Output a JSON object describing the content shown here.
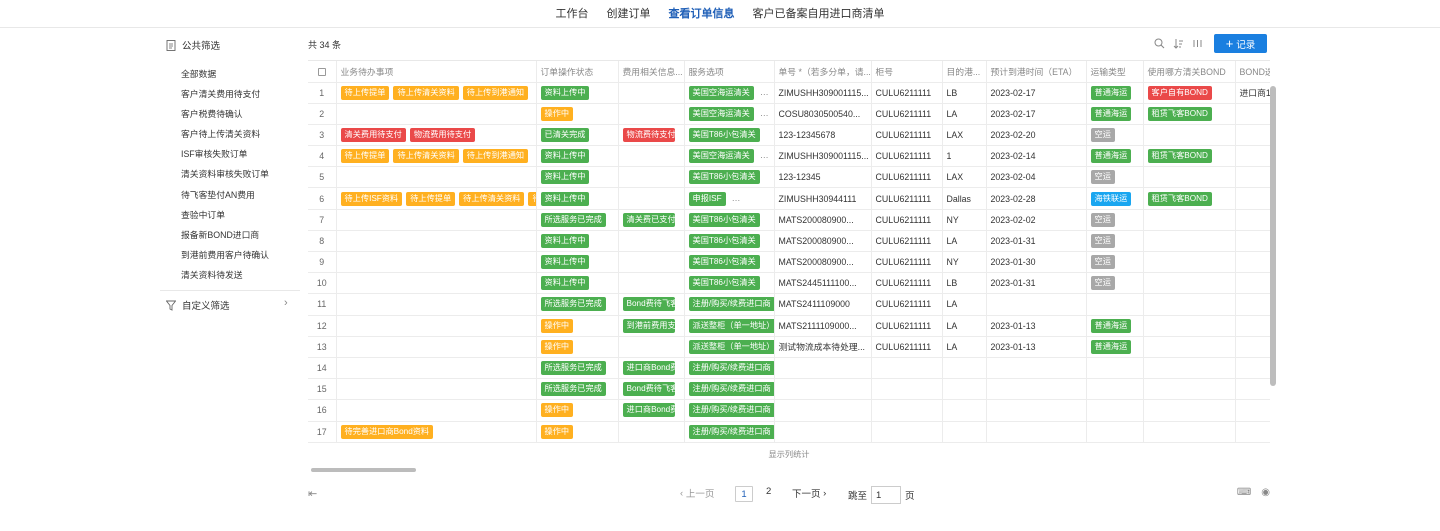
{
  "nav": {
    "tabs": [
      {
        "label": "工作台",
        "active": false
      },
      {
        "label": "创建订单",
        "active": false
      },
      {
        "label": "查看订单信息",
        "active": true
      },
      {
        "label": "客户已备案自用进口商清单",
        "active": false
      }
    ]
  },
  "sidebar": {
    "public_title": "公共筛选",
    "filters": [
      "全部数据",
      "客户清关费用待支付",
      "客户税费待确认",
      "客户待上传清关资料",
      "ISF审核失败订单",
      "清关资料审核失败订单",
      "待飞客垫付AN费用",
      "查验中订单",
      "报备新BOND进口商",
      "到港前费用客户待确认",
      "清关资料待发送"
    ],
    "custom_title": "自定义筛选"
  },
  "main": {
    "total": "共 34 条",
    "record_label": "记录",
    "stats_label": "显示列统计"
  },
  "table": {
    "headers": [
      "业务待办事项",
      "订单操作状态",
      "费用相关信息...",
      "服务选项",
      "单号 *（若多分单，请...",
      "柜号",
      "目的港...",
      "预计到港时间（ETA）",
      "运输类型",
      "使用哪方清关BOND",
      "BOND选"
    ],
    "rows": [
      {
        "idx": "1",
        "todo": [
          {
            "t": "待上传提单",
            "c": "yellow"
          },
          {
            "t": "待上传清关资料",
            "c": "yellow"
          },
          {
            "t": "待上传到港通知",
            "c": "yellow"
          }
        ],
        "status": [
          {
            "t": "资料上传中",
            "c": "green"
          }
        ],
        "fee": [],
        "svc": [
          {
            "t": "美国空海运清关",
            "c": "green"
          }
        ],
        "svc_more": true,
        "no": "ZIMUSHH309001115...",
        "box": "CULU6211111",
        "port": "LB",
        "eta": "2023-02-17",
        "trans": [
          {
            "t": "普通海运",
            "c": "green"
          }
        ],
        "bond": [
          {
            "t": "客户自有BOND",
            "c": "red"
          }
        ],
        "bond2": "进口商1"
      },
      {
        "idx": "2",
        "todo": [],
        "status": [
          {
            "t": "操作中",
            "c": "yellow"
          }
        ],
        "fee": [],
        "svc": [
          {
            "t": "美国空海运清关",
            "c": "green"
          }
        ],
        "svc_more": true,
        "no": "COSU8030500540...",
        "box": "CULU6211111",
        "port": "LA",
        "eta": "2023-02-17",
        "trans": [
          {
            "t": "普通海运",
            "c": "green"
          }
        ],
        "bond": [
          {
            "t": "租赁飞客BOND",
            "c": "green"
          }
        ],
        "bond2": ""
      },
      {
        "idx": "3",
        "todo": [
          {
            "t": "清关费用待支付",
            "c": "red"
          },
          {
            "t": "物流费用待支付",
            "c": "red"
          }
        ],
        "status": [
          {
            "t": "已清关完成",
            "c": "green"
          }
        ],
        "fee": [
          {
            "t": "物流费待支付",
            "c": "red"
          }
        ],
        "svc": [
          {
            "t": "美国T86小包清关",
            "c": "green"
          }
        ],
        "svc_more": false,
        "no": "123-12345678",
        "box": "CULU6211111",
        "port": "LAX",
        "eta": "2023-02-20",
        "trans": [
          {
            "t": "空运",
            "c": "grey"
          }
        ],
        "bond": [],
        "bond2": ""
      },
      {
        "idx": "4",
        "todo": [
          {
            "t": "待上传提单",
            "c": "yellow"
          },
          {
            "t": "待上传清关资料",
            "c": "yellow"
          },
          {
            "t": "待上传到港通知",
            "c": "yellow"
          }
        ],
        "status": [
          {
            "t": "资料上传中",
            "c": "green"
          }
        ],
        "fee": [],
        "svc": [
          {
            "t": "美国空海运清关",
            "c": "green"
          }
        ],
        "svc_more": true,
        "no": "ZIMUSHH309001115...",
        "box": "CULU6211111",
        "port": "1",
        "eta": "2023-02-14",
        "trans": [
          {
            "t": "普通海运",
            "c": "green"
          }
        ],
        "bond": [
          {
            "t": "租赁飞客BOND",
            "c": "green"
          }
        ],
        "bond2": ""
      },
      {
        "idx": "5",
        "todo": [],
        "status": [
          {
            "t": "资料上传中",
            "c": "green"
          }
        ],
        "fee": [],
        "svc": [
          {
            "t": "美国T86小包清关",
            "c": "green"
          }
        ],
        "svc_more": false,
        "no": "123-12345",
        "box": "CULU6211111",
        "port": "LAX",
        "eta": "2023-02-04",
        "trans": [
          {
            "t": "空运",
            "c": "grey"
          }
        ],
        "bond": [],
        "bond2": ""
      },
      {
        "idx": "6",
        "todo": [
          {
            "t": "待上传ISF资料",
            "c": "yellow"
          },
          {
            "t": "待上传提单",
            "c": "yellow"
          },
          {
            "t": "待上传清关资料",
            "c": "yellow"
          },
          {
            "t": "待",
            "c": "yellow"
          }
        ],
        "status": [
          {
            "t": "资料上传中",
            "c": "green"
          }
        ],
        "fee": [],
        "svc": [
          {
            "t": "申报ISF",
            "c": "green"
          }
        ],
        "svc_more": true,
        "no": "ZIMUSHH30944111",
        "box": "CULU6211111",
        "port": "Dallas",
        "eta": "2023-02-28",
        "trans": [
          {
            "t": "海铁联运",
            "c": "blue"
          }
        ],
        "bond": [
          {
            "t": "租赁飞客BOND",
            "c": "green"
          }
        ],
        "bond2": ""
      },
      {
        "idx": "7",
        "todo": [],
        "status": [
          {
            "t": "所选服务已完成",
            "c": "green"
          }
        ],
        "fee": [
          {
            "t": "清关费已支付",
            "c": "green"
          }
        ],
        "svc": [
          {
            "t": "美国T86小包清关",
            "c": "green"
          }
        ],
        "svc_more": false,
        "no": "MATS200080900...",
        "box": "CULU6211111",
        "port": "NY",
        "eta": "2023-02-02",
        "trans": [
          {
            "t": "空运",
            "c": "grey"
          }
        ],
        "bond": [],
        "bond2": ""
      },
      {
        "idx": "8",
        "todo": [],
        "status": [
          {
            "t": "资料上传中",
            "c": "green"
          }
        ],
        "fee": [],
        "svc": [
          {
            "t": "美国T86小包清关",
            "c": "green"
          }
        ],
        "svc_more": false,
        "no": "MATS200080900...",
        "box": "CULU6211111",
        "port": "LA",
        "eta": "2023-01-31",
        "trans": [
          {
            "t": "空运",
            "c": "grey"
          }
        ],
        "bond": [],
        "bond2": ""
      },
      {
        "idx": "9",
        "todo": [],
        "status": [
          {
            "t": "资料上传中",
            "c": "green"
          }
        ],
        "fee": [],
        "svc": [
          {
            "t": "美国T86小包清关",
            "c": "green"
          }
        ],
        "svc_more": false,
        "no": "MATS200080900...",
        "box": "CULU6211111",
        "port": "NY",
        "eta": "2023-01-30",
        "trans": [
          {
            "t": "空运",
            "c": "grey"
          }
        ],
        "bond": [],
        "bond2": ""
      },
      {
        "idx": "10",
        "todo": [],
        "status": [
          {
            "t": "资料上传中",
            "c": "green"
          }
        ],
        "fee": [],
        "svc": [
          {
            "t": "美国T86小包清关",
            "c": "green"
          }
        ],
        "svc_more": false,
        "no": "MATS2445111100...",
        "box": "CULU6211111",
        "port": "LB",
        "eta": "2023-01-31",
        "trans": [
          {
            "t": "空运",
            "c": "grey"
          }
        ],
        "bond": [],
        "bond2": ""
      },
      {
        "idx": "11",
        "todo": [],
        "status": [
          {
            "t": "所选服务已完成",
            "c": "green"
          }
        ],
        "fee": [
          {
            "t": "Bond费待飞客",
            "c": "green"
          }
        ],
        "svc": [
          {
            "t": "注册/购买/续费进口商",
            "c": "green"
          }
        ],
        "svc_more": false,
        "no": "MATS2411109000",
        "box": "CULU6211111",
        "port": "LA",
        "eta": "",
        "trans": [],
        "bond": [],
        "bond2": ""
      },
      {
        "idx": "12",
        "todo": [],
        "status": [
          {
            "t": "操作中",
            "c": "yellow"
          }
        ],
        "fee": [
          {
            "t": "到港前费用支付",
            "c": "green"
          }
        ],
        "svc": [
          {
            "t": "派送整柜（单一地址）",
            "c": "green"
          }
        ],
        "svc_more": false,
        "no": "MATS2111109000...",
        "box": "CULU6211111",
        "port": "LA",
        "eta": "2023-01-13",
        "trans": [
          {
            "t": "普通海运",
            "c": "green"
          }
        ],
        "bond": [],
        "bond2": ""
      },
      {
        "idx": "13",
        "todo": [],
        "status": [
          {
            "t": "操作中",
            "c": "yellow"
          }
        ],
        "fee": [],
        "svc": [
          {
            "t": "派送整柜（单一地址）",
            "c": "green"
          }
        ],
        "svc_more": false,
        "no": "测试物流成本待处理...",
        "box": "CULU6211111",
        "port": "LA",
        "eta": "2023-01-13",
        "trans": [
          {
            "t": "普通海运",
            "c": "green"
          }
        ],
        "bond": [],
        "bond2": ""
      },
      {
        "idx": "14",
        "todo": [],
        "status": [
          {
            "t": "所选服务已完成",
            "c": "green"
          }
        ],
        "fee": [
          {
            "t": "进口商Bond费",
            "c": "green"
          }
        ],
        "svc": [
          {
            "t": "注册/购买/续费进口商",
            "c": "green"
          }
        ],
        "svc_more": false,
        "no": "",
        "box": "",
        "port": "",
        "eta": "",
        "trans": [],
        "bond": [],
        "bond2": ""
      },
      {
        "idx": "15",
        "todo": [],
        "status": [
          {
            "t": "所选服务已完成",
            "c": "green"
          }
        ],
        "fee": [
          {
            "t": "Bond费待飞客",
            "c": "green"
          }
        ],
        "svc": [
          {
            "t": "注册/购买/续费进口商",
            "c": "green"
          }
        ],
        "svc_more": false,
        "no": "",
        "box": "",
        "port": "",
        "eta": "",
        "trans": [],
        "bond": [],
        "bond2": ""
      },
      {
        "idx": "16",
        "todo": [],
        "status": [
          {
            "t": "操作中",
            "c": "yellow"
          }
        ],
        "fee": [
          {
            "t": "进口商Bond费",
            "c": "green"
          }
        ],
        "svc": [
          {
            "t": "注册/购买/续费进口商",
            "c": "green"
          }
        ],
        "svc_more": false,
        "no": "",
        "box": "",
        "port": "",
        "eta": "",
        "trans": [],
        "bond": [],
        "bond2": ""
      },
      {
        "idx": "17",
        "todo": [
          {
            "t": "待完善进口商Bond资料",
            "c": "yellow"
          }
        ],
        "status": [
          {
            "t": "操作中",
            "c": "yellow"
          }
        ],
        "fee": [],
        "svc": [
          {
            "t": "注册/购买/续费进口商",
            "c": "green"
          }
        ],
        "svc_more": false,
        "no": "",
        "box": "",
        "port": "",
        "eta": "",
        "trans": [],
        "bond": [],
        "bond2": ""
      }
    ]
  },
  "pagination": {
    "prev": "上一页",
    "pages": [
      "1",
      "2"
    ],
    "current": "1",
    "next": "下一页",
    "goto_label": "跳至",
    "goto_value": "1",
    "page_unit": "页"
  }
}
